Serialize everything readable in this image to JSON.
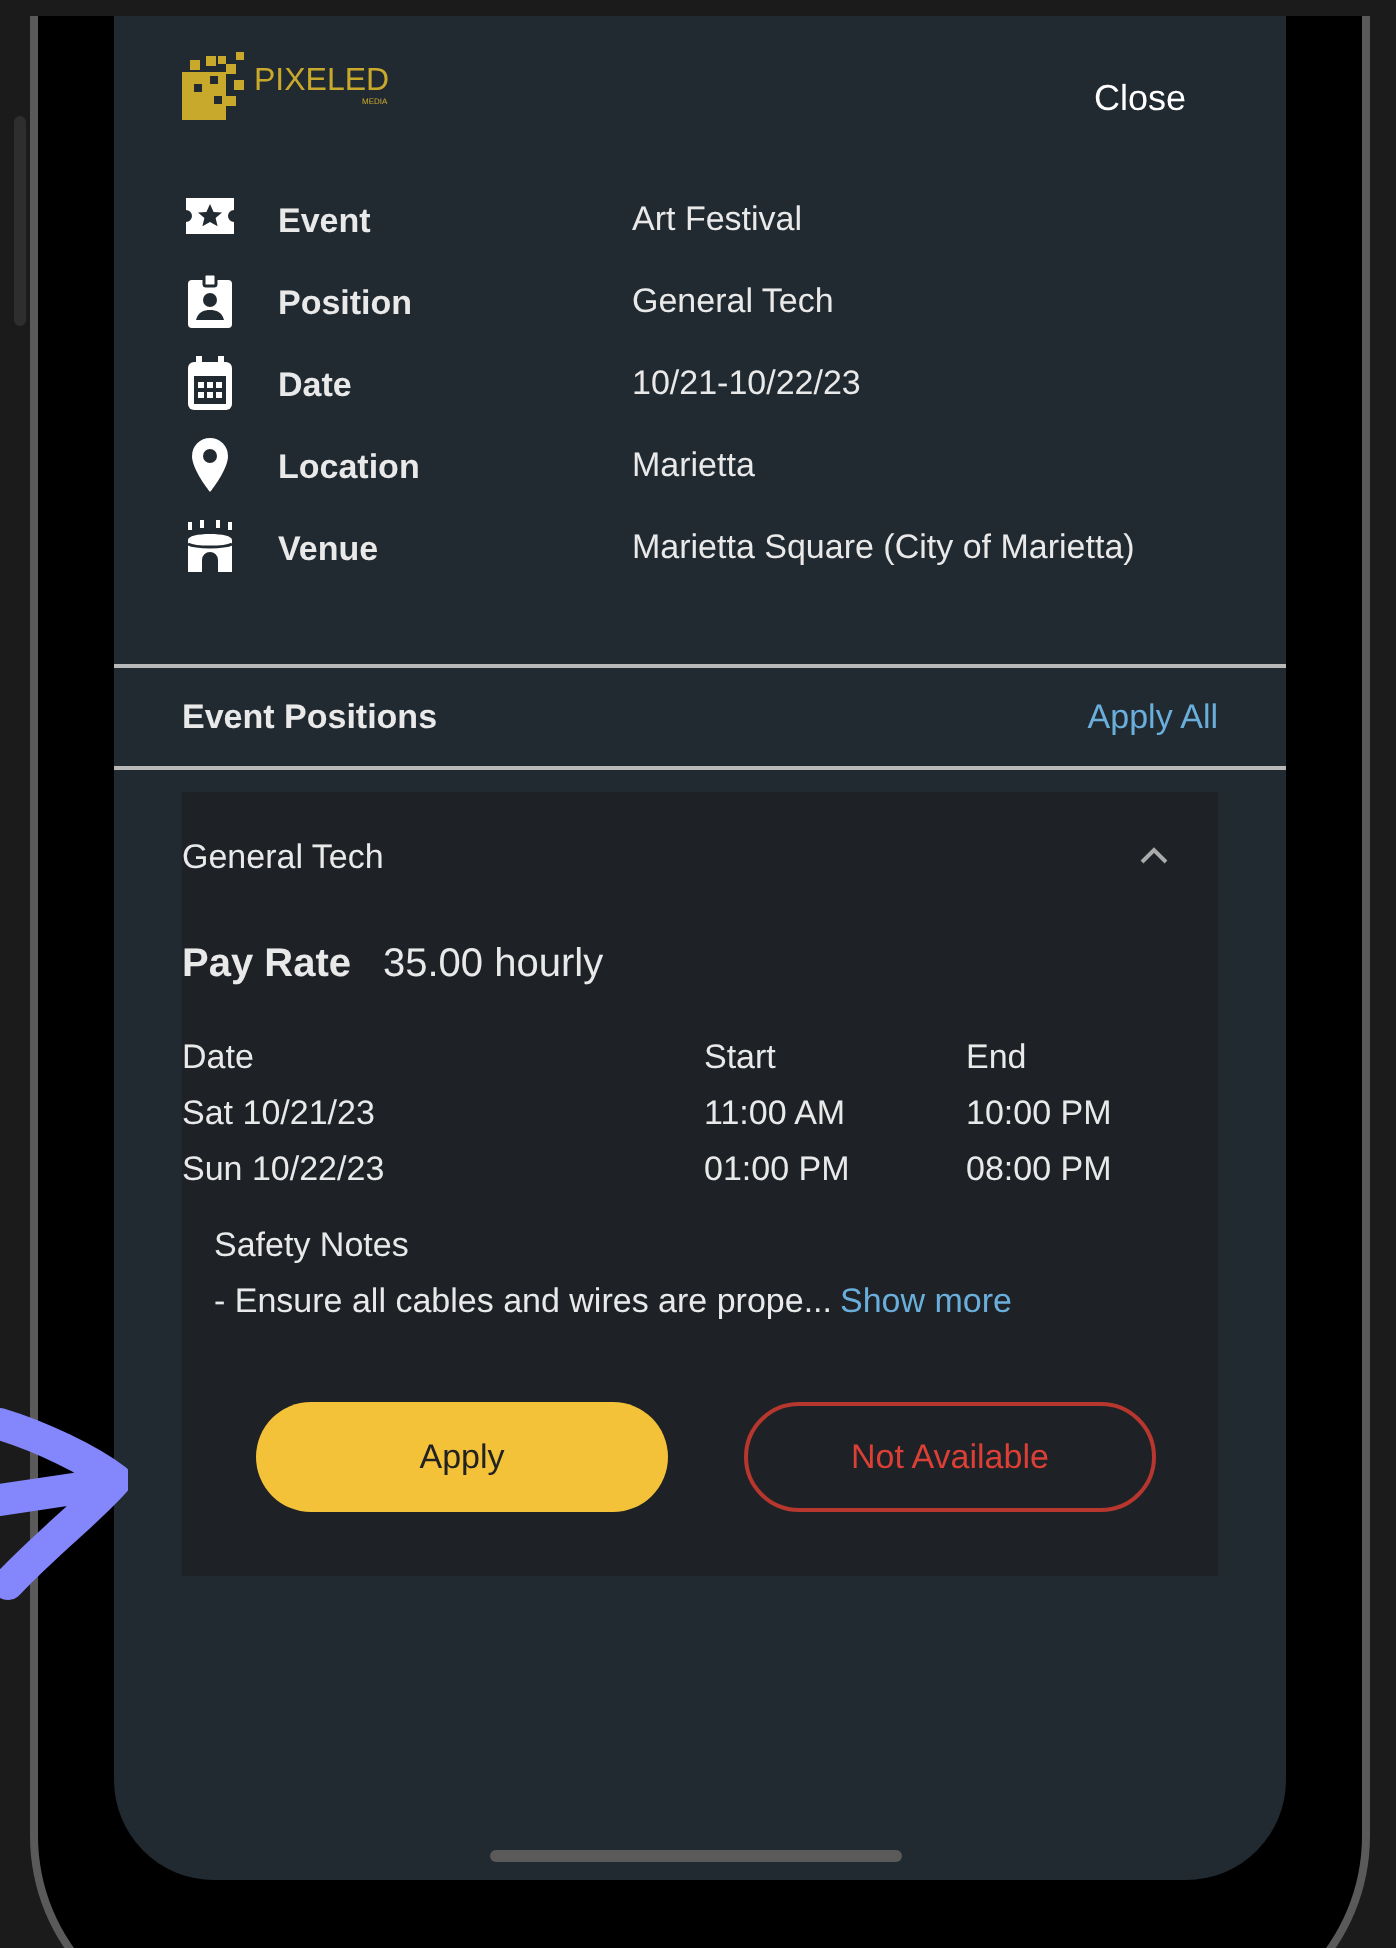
{
  "header": {
    "logo_text": "PIXELED",
    "logo_subtext": "MEDIA",
    "close": "Close"
  },
  "details": [
    {
      "kind": "ticket",
      "label": "Event",
      "value": "Art Festival"
    },
    {
      "kind": "badge",
      "label": "Position",
      "value": "General Tech"
    },
    {
      "kind": "calendar",
      "label": "Date",
      "value": "10/21-10/22/23"
    },
    {
      "kind": "pin",
      "label": "Location",
      "value": "Marietta"
    },
    {
      "kind": "venue",
      "label": "Venue",
      "value": "Marietta Square (City of Marietta)"
    }
  ],
  "positions": {
    "title": "Event Positions",
    "action": "Apply All"
  },
  "position_card": {
    "title": "General Tech",
    "expanded": true,
    "pay_rate_label": "Pay Rate",
    "pay_rate": "35.00 hourly",
    "schedule": {
      "columns": [
        "Date",
        "Start",
        "End"
      ],
      "rows": [
        [
          "Sat 10/21/23",
          "11:00 AM",
          "10:00 PM"
        ],
        [
          "Sun 10/22/23",
          "01:00 PM",
          "08:00 PM"
        ]
      ]
    },
    "notes_title": "Safety Notes",
    "note": "- Ensure all cables and wires are prope...",
    "show_more": "Show more",
    "buttons": [
      {
        "kind": "primary",
        "label": "Apply"
      },
      {
        "kind": "outline",
        "label": "Not Available"
      }
    ]
  }
}
